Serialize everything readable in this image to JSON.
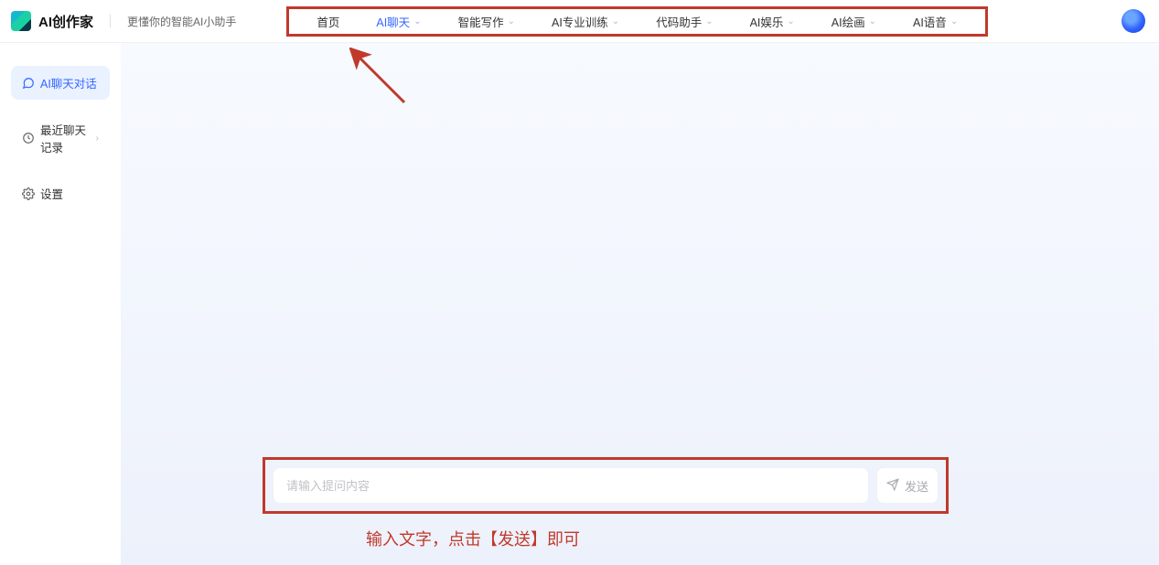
{
  "header": {
    "app_title": "AI创作家",
    "tagline": "更懂你的智能AI小助手",
    "nav": [
      {
        "label": "首页",
        "has_chevron": false,
        "active": false
      },
      {
        "label": "AI聊天",
        "has_chevron": true,
        "active": true
      },
      {
        "label": "智能写作",
        "has_chevron": true,
        "active": false
      },
      {
        "label": "AI专业训练",
        "has_chevron": true,
        "active": false
      },
      {
        "label": "代码助手",
        "has_chevron": true,
        "active": false
      },
      {
        "label": "AI娱乐",
        "has_chevron": true,
        "active": false
      },
      {
        "label": "AI绘画",
        "has_chevron": true,
        "active": false
      },
      {
        "label": "AI语音",
        "has_chevron": true,
        "active": false
      }
    ]
  },
  "sidebar": {
    "items": [
      {
        "label": "AI聊天对话",
        "icon": "chat-icon",
        "active": true,
        "has_chevron": false
      },
      {
        "label": "最近聊天记录",
        "icon": "clock-icon",
        "active": false,
        "has_chevron": true
      },
      {
        "label": "设置",
        "icon": "gear-icon",
        "active": false,
        "has_chevron": false
      }
    ]
  },
  "input_area": {
    "placeholder": "请输入提问内容",
    "send_label": "发送"
  },
  "annotations": {
    "helper_text": "输入文字，点击【发送】即可"
  },
  "colors": {
    "accent": "#3366ff",
    "annotation_red": "#c0392b"
  }
}
